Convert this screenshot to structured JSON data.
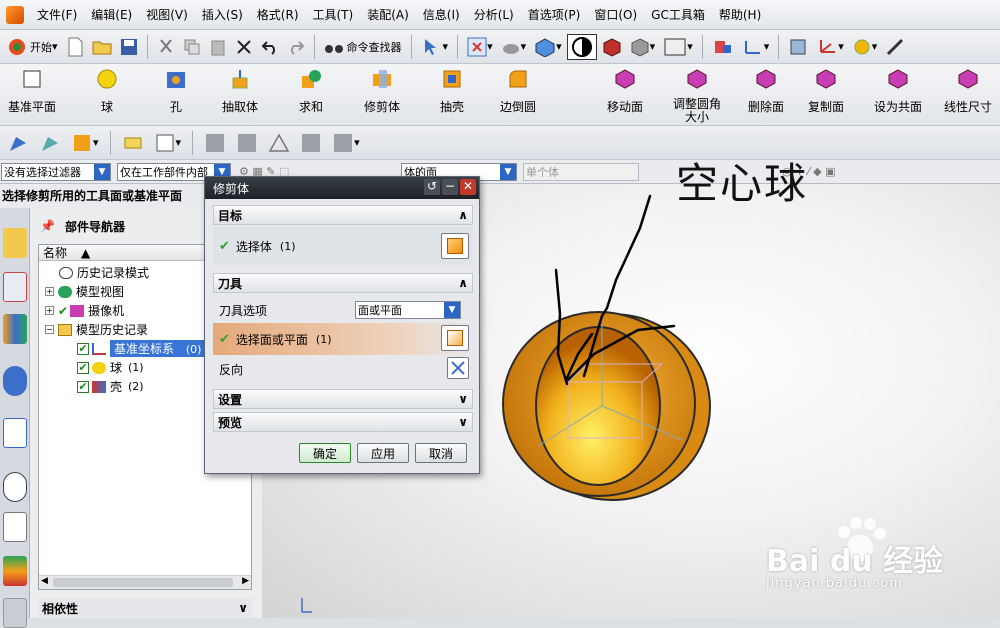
{
  "menu": {
    "items": [
      "文件(F)",
      "编辑(E)",
      "视图(V)",
      "插入(S)",
      "格式(R)",
      "工具(T)",
      "装配(A)",
      "信息(I)",
      "分析(L)",
      "首选项(P)",
      "窗口(O)",
      "GC工具箱",
      "帮助(H)"
    ]
  },
  "toolbar": {
    "start_label": "开始",
    "command_finder": "命令查找器"
  },
  "feature_toolbar": {
    "items": [
      "基准平面",
      "球",
      "孔",
      "抽取体",
      "求和",
      "修剪体",
      "抽壳",
      "边倒圆",
      "移动面",
      "调整圆角大小",
      "删除面",
      "复制面",
      "设为共面",
      "线性尺寸"
    ]
  },
  "filters": {
    "selection_filter": "没有选择过滤器",
    "scope": "仅在工作部件内部",
    "face_rule": "体的面",
    "body_filter": "单个体"
  },
  "status": {
    "prompt": "选择修剪所用的工具面或基准平面"
  },
  "navigator": {
    "title": "部件导航器",
    "column_name": "名称",
    "nodes": [
      {
        "label": "历史记录模式"
      },
      {
        "label": "模型视图"
      },
      {
        "label": "摄像机"
      },
      {
        "label": "模型历史记录"
      },
      {
        "label": "基准坐标系",
        "suffix": "(0)"
      },
      {
        "label": "球",
        "suffix": "(1)"
      },
      {
        "label": "壳",
        "suffix": "(2)"
      }
    ],
    "dependencies": "相依性"
  },
  "dialog": {
    "title": "修剪体",
    "target_section": "目标",
    "select_body": "选择体",
    "select_body_count": "(1)",
    "tool_section": "刀具",
    "tool_option_label": "刀具选项",
    "tool_option_value": "面或平面",
    "select_face": "选择面或平面",
    "select_face_count": "(1)",
    "reverse": "反向",
    "settings": "设置",
    "preview": "预览",
    "ok": "确定",
    "apply": "应用",
    "cancel": "取消"
  },
  "annotation": {
    "text": "空心球"
  },
  "watermark": {
    "brand": "Bai du 经验",
    "url": "jingyan.baidu.com"
  },
  "colors": {
    "accent_blue": "#3875d7",
    "selection_orange": "#e4a97a",
    "shell_orange": "#e8950f",
    "dialog_title": "#1d2127"
  }
}
